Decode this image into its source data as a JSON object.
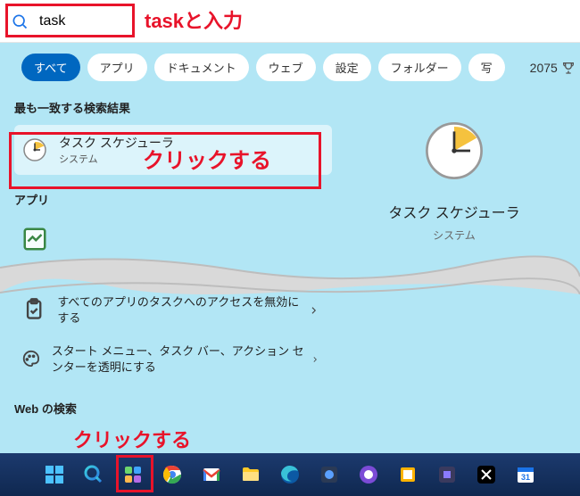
{
  "search": {
    "value": "task",
    "placeholder": ""
  },
  "annotations": {
    "search_label": "taskと入力",
    "best_label": "クリックする",
    "taskbar_label": "クリックする"
  },
  "tabs": {
    "active": "すべて",
    "items": [
      "アプリ",
      "ドキュメント",
      "ウェブ",
      "設定",
      "フォルダー",
      "写"
    ]
  },
  "points": "2075",
  "headings": {
    "best": "最も一致する検索結果",
    "apps": "アプリ",
    "web": "Web の検索"
  },
  "best_match": {
    "title": "タスク スケジューラ",
    "subtitle": "システム"
  },
  "preview": {
    "title": "タスク スケジューラ",
    "subtitle": "システム"
  },
  "settings": [
    {
      "text": "すべてのアプリのタスクへのアクセスを無効にする"
    },
    {
      "text": "スタート メニュー、タスク バー、アクション センターを透明にする"
    }
  ]
}
